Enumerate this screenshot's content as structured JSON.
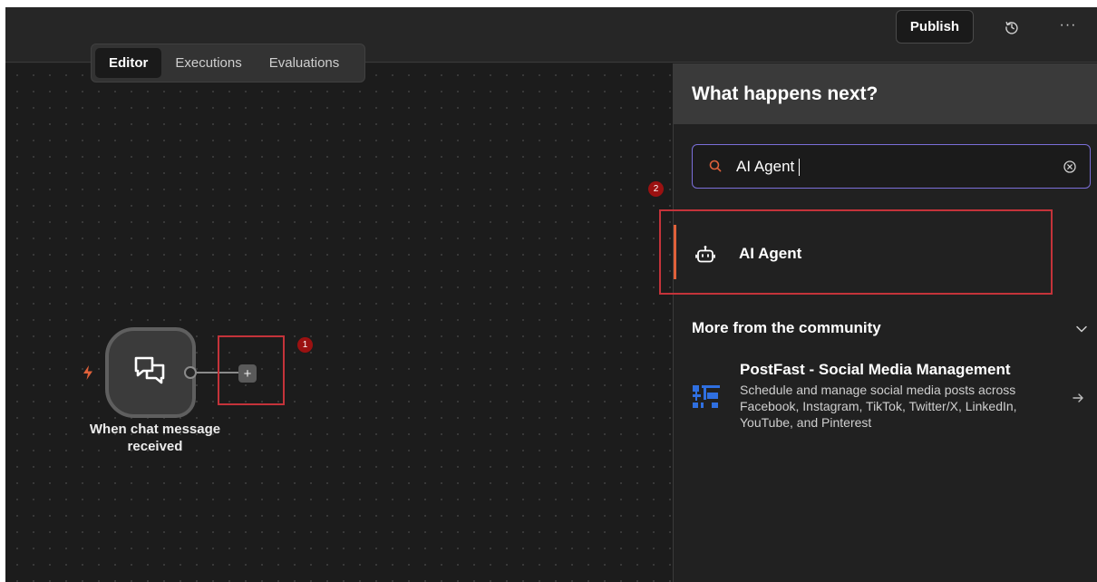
{
  "topbar": {
    "publish_label": "Publish",
    "history_icon": "history-icon",
    "more_label": "···"
  },
  "mode_tabs": [
    {
      "label": "Editor",
      "active": true
    },
    {
      "label": "Executions",
      "active": false
    },
    {
      "label": "Evaluations",
      "active": false
    }
  ],
  "canvas": {
    "trigger_node": {
      "label": "When chat message received",
      "icon": "chat-bubbles-icon",
      "trigger_icon": "lightning-bolt-icon"
    },
    "add_node_label": "+",
    "badges": [
      "1",
      "2"
    ]
  },
  "panel": {
    "title": "What happens next?",
    "search": {
      "value": "AI Agent",
      "placeholder": ""
    },
    "results": [
      {
        "label": "AI Agent",
        "icon": "robot-icon"
      }
    ],
    "community": {
      "title": "More from the community",
      "items": [
        {
          "title": "PostFast - Social Media Management",
          "description": "Schedule and manage social media posts across Facebook, Instagram, TikTok, Twitter/X, LinkedIn, YouTube, and Pinterest",
          "icon": "postfast-icon"
        }
      ]
    }
  },
  "colors": {
    "accent_orange": "#e0613a",
    "highlight_red": "#c4333a",
    "badge_red": "#9b1111",
    "search_border": "#7b6fd9",
    "postfast_blue": "#2f6fe0"
  }
}
